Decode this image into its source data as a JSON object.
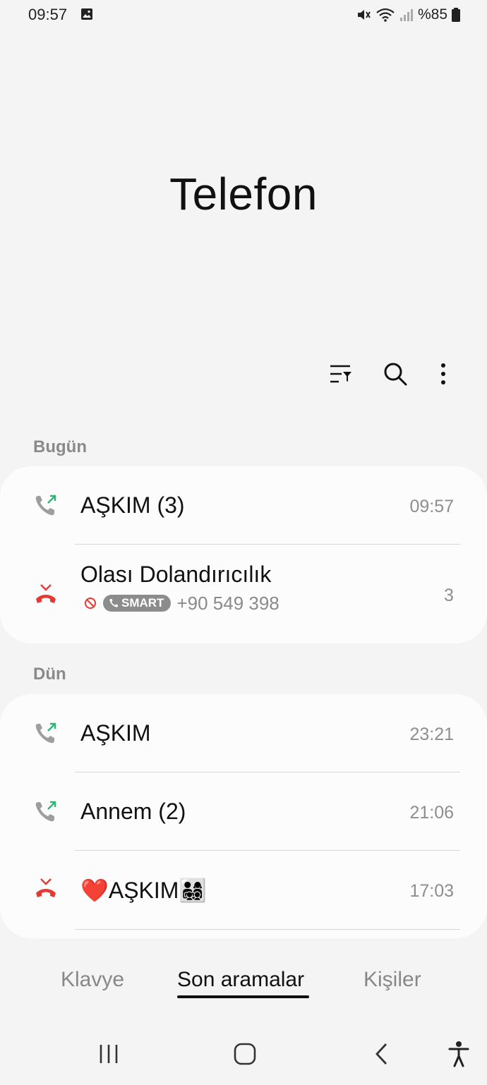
{
  "status_bar": {
    "time": "09:57",
    "battery": "%85"
  },
  "app": {
    "title": "Telefon"
  },
  "sections": [
    {
      "label": "Bugün",
      "calls": [
        {
          "name": "AŞKIM (3)",
          "time": "09:57",
          "type": "outgoing"
        },
        {
          "name": "Olası Dolandırıcılık",
          "time": "3",
          "type": "missed",
          "badge": "SMART",
          "number": "+90 549 398"
        }
      ]
    },
    {
      "label": "Dün",
      "calls": [
        {
          "name": "AŞKIM",
          "time": "23:21",
          "type": "outgoing"
        },
        {
          "name": "Annem (2)",
          "time": "21:06",
          "type": "outgoing"
        },
        {
          "name": "❤️AŞKIM👨‍👩‍👧‍👦",
          "time": "17:03",
          "type": "missed"
        }
      ]
    }
  ],
  "tabs": {
    "keypad": "Klavye",
    "recents": "Son aramalar",
    "contacts": "Kişiler"
  },
  "colors": {
    "outgoing_arrow": "#2bb673",
    "missed_red": "#e53935",
    "handset_gray": "#9e9e9e"
  }
}
